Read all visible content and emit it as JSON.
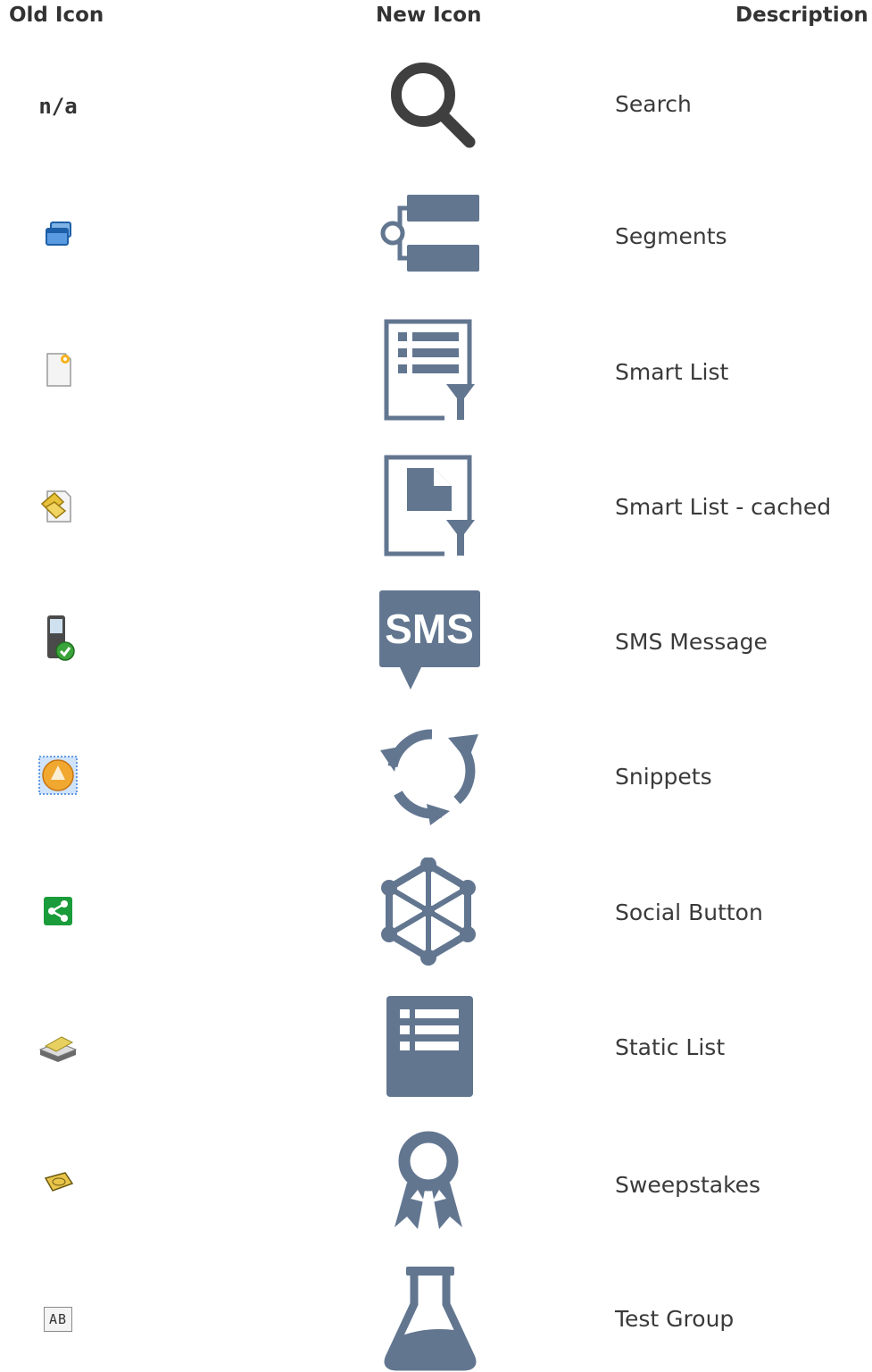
{
  "headers": {
    "old": "Old Icon",
    "new": "New Icon",
    "description": "Description"
  },
  "colors": {
    "icon": "#627690",
    "text": "#3a3a3a"
  },
  "rows": [
    {
      "old": "n/a",
      "old_icon": "none",
      "new_icon": "search-icon",
      "description": "Search"
    },
    {
      "old_icon": "segments-old-icon",
      "new_icon": "segments-icon",
      "description": "Segments"
    },
    {
      "old_icon": "smart-list-old-icon",
      "new_icon": "smart-list-icon",
      "description": "Smart List"
    },
    {
      "old_icon": "smart-list-cached-old-icon",
      "new_icon": "smart-list-cached-icon",
      "description": "Smart List - cached"
    },
    {
      "old_icon": "sms-old-icon",
      "new_icon": "sms-icon",
      "sms_text": "SMS",
      "description": "SMS Message"
    },
    {
      "old_icon": "snippets-old-icon",
      "new_icon": "snippets-icon",
      "description": "Snippets"
    },
    {
      "old_icon": "social-button-old-icon",
      "new_icon": "social-button-icon",
      "description": "Social Button"
    },
    {
      "old_icon": "static-list-old-icon",
      "new_icon": "static-list-icon",
      "description": "Static List"
    },
    {
      "old_icon": "sweepstakes-old-icon",
      "new_icon": "sweepstakes-icon",
      "description": "Sweepstakes"
    },
    {
      "old_icon": "test-group-old-icon",
      "new_icon": "test-group-icon",
      "old_text": "AB",
      "description": "Test Group"
    }
  ]
}
